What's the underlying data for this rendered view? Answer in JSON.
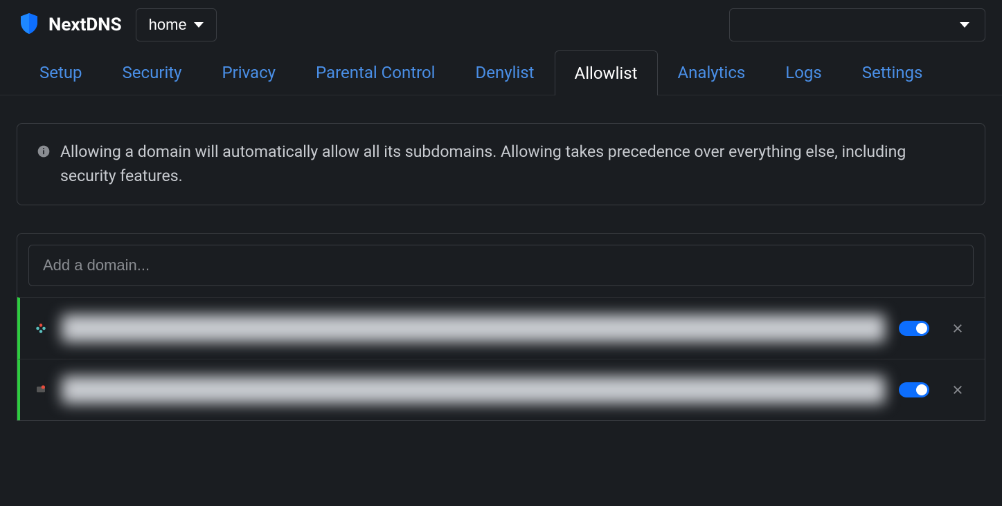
{
  "brand": "NextDNS",
  "profile_selector": {
    "label": "home"
  },
  "nav": {
    "items": [
      {
        "label": "Setup",
        "active": false
      },
      {
        "label": "Security",
        "active": false
      },
      {
        "label": "Privacy",
        "active": false
      },
      {
        "label": "Parental Control",
        "active": false
      },
      {
        "label": "Denylist",
        "active": false
      },
      {
        "label": "Allowlist",
        "active": true
      },
      {
        "label": "Analytics",
        "active": false
      },
      {
        "label": "Logs",
        "active": false
      },
      {
        "label": "Settings",
        "active": false
      }
    ]
  },
  "info": {
    "text": "Allowing a domain will automatically allow all its subdomains. Allowing takes precedence over everything else, including security features."
  },
  "add_domain": {
    "placeholder": "Add a domain..."
  },
  "allowlist": [
    {
      "domain": "",
      "icon": "flower-icon",
      "enabled": true
    },
    {
      "domain": "",
      "icon": "app-icon",
      "enabled": true
    }
  ],
  "colors": {
    "accent_link": "#4a8fe7",
    "toggle_on": "#0d6efd",
    "allow_border": "#2ecc40"
  }
}
